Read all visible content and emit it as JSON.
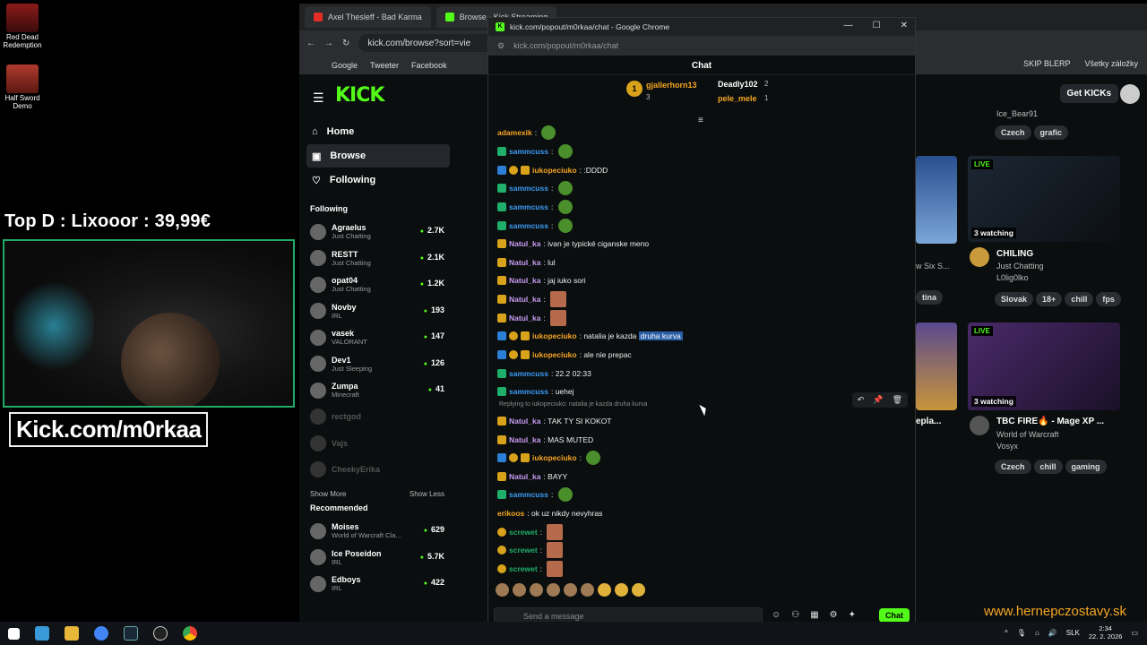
{
  "desktop": {
    "icons": [
      {
        "label": "Red Dead Redemption"
      },
      {
        "label": "Half Sword Demo"
      }
    ],
    "overlay_title": "Top D : Lixooor : 39,99€",
    "overlay_url": "Kick.com/m0rkaa",
    "watermark": "www.hernepczostavy.sk"
  },
  "back_browser": {
    "tabs": [
      {
        "label": "Axel Thesleff - Bad Karma"
      },
      {
        "label": "Browse - Kick Streaming"
      }
    ],
    "address": "kick.com/browse?sort=vie",
    "bookmarks": [
      "Google",
      "Tweeter",
      "Facebook"
    ],
    "bookmarks_right": [
      "SKIP BLERP",
      "Všetky záložky"
    ],
    "get_kicks": "Get KICKs",
    "logo": "KICK",
    "nav": [
      {
        "label": "Home",
        "icon": "home-icon"
      },
      {
        "label": "Browse",
        "icon": "browse-icon",
        "active": true
      },
      {
        "label": "Following",
        "icon": "heart-icon"
      }
    ],
    "following_title": "Following",
    "following": [
      {
        "name": "Agraelus",
        "sub": "Just Chatting",
        "viewers": "2.7K"
      },
      {
        "name": "RESTT",
        "sub": "Just Chatting",
        "viewers": "2.1K"
      },
      {
        "name": "opat04",
        "sub": "Just Chatting",
        "viewers": "1.2K"
      },
      {
        "name": "Novby",
        "sub": "IRL",
        "viewers": "193"
      },
      {
        "name": "vasek",
        "sub": "VALORANT",
        "viewers": "147"
      },
      {
        "name": "Dev1",
        "sub": "Just Sleeping",
        "viewers": "126"
      },
      {
        "name": "Zumpa",
        "sub": "Minecraft",
        "viewers": "41"
      }
    ],
    "offline": [
      "rectgod",
      "Vajs",
      "CheekyErika"
    ],
    "show_more": "Show More",
    "show_less": "Show Less",
    "recommended_title": "Recommended",
    "recommended": [
      {
        "name": "Moises",
        "sub": "World of Warcraft Cla...",
        "viewers": "629"
      },
      {
        "name": "Ice Poseidon",
        "sub": "IRL",
        "viewers": "5.7K"
      },
      {
        "name": "Edboys",
        "sub": "IRL",
        "viewers": "422"
      }
    ],
    "cards": [
      {
        "tags": [
          "Czech",
          "grafic"
        ],
        "top_text": "Ice_Bear91"
      },
      {
        "live": "LIVE",
        "watching": "3 watching",
        "title": "CHILING",
        "sub1": "Just Chatting",
        "sub2": "L0lig0lko",
        "tags": [
          "Slovak",
          "18+",
          "chill",
          "fps"
        ]
      },
      {
        "live": "LIVE",
        "watching": "3 watching",
        "title": "TBC FIRE🔥 - Mage XP ...",
        "sub1": "World of Warcraft",
        "sub2": "Vosyx",
        "tags": [
          "Czech",
          "chill",
          "gaming"
        ]
      }
    ],
    "partial_labels": [
      "w Six S...",
      "tina",
      "epla..."
    ]
  },
  "chat_window": {
    "title": "kick.com/popout/m0rkaa/chat - Google Chrome",
    "url": "kick.com/popout/m0rkaa/chat",
    "header": "Chat",
    "leaderboard": [
      {
        "rank": "1",
        "name": "gjallerhorn13",
        "count": "3"
      },
      {
        "name": "Deadly102",
        "count": "2"
      },
      {
        "name": "pele_mele",
        "count": "1"
      }
    ],
    "messages": [
      {
        "user": "adamexik",
        "color": "#f5a623",
        "text": "",
        "emote": "green"
      },
      {
        "user": "sammcuss",
        "color": "#3b9cf5",
        "text": "",
        "emote": "green",
        "badges": [
          "mod"
        ]
      },
      {
        "user": "iukopeciuko",
        "color": "#f5a623",
        "text": ":DDDD",
        "badges": [
          "sub",
          "gift",
          "crown"
        ]
      },
      {
        "user": "sammcuss",
        "color": "#3b9cf5",
        "text": "",
        "emote": "green",
        "badges": [
          "mod"
        ]
      },
      {
        "user": "sammcuss",
        "color": "#3b9cf5",
        "text": "",
        "emote": "green",
        "badges": [
          "mod"
        ]
      },
      {
        "user": "sammcuss",
        "color": "#3b9cf5",
        "text": "",
        "emote": "green",
        "badges": [
          "mod"
        ]
      },
      {
        "user": "Natul_ka",
        "color": "#c79bf2",
        "text": "ivan je typické ciganske meno",
        "badges": [
          "crown"
        ]
      },
      {
        "user": "Natul_ka",
        "color": "#c79bf2",
        "text": "lul",
        "badges": [
          "crown"
        ]
      },
      {
        "user": "Natul_ka",
        "color": "#c79bf2",
        "text": "jaj iuko sori",
        "badges": [
          "crown"
        ]
      },
      {
        "user": "Natul_ka",
        "color": "#c79bf2",
        "text": "",
        "emote": "img",
        "badges": [
          "crown"
        ]
      },
      {
        "user": "Natul_ka",
        "color": "#c79bf2",
        "text": "",
        "emote": "img",
        "badges": [
          "crown"
        ]
      },
      {
        "user": "iukopeciuko",
        "color": "#f5a623",
        "text": "natalia je kazda",
        "highlight": "druha kurva",
        "badges": [
          "sub",
          "gift",
          "crown"
        ]
      },
      {
        "user": "iukopeciuko",
        "color": "#f5a623",
        "text": "ale nie prepac",
        "badges": [
          "sub",
          "gift",
          "crown"
        ]
      },
      {
        "user": "sammcuss",
        "color": "#3b9cf5",
        "text": "22.2 02:33",
        "badges": [
          "mod"
        ]
      },
      {
        "user": "sammcuss",
        "color": "#3b9cf5",
        "text": "uehej",
        "badges": [
          "mod"
        ]
      },
      {
        "user": "Natul_ka",
        "color": "#c79bf2",
        "text": "TAK TY SI KOKOT",
        "badges": [
          "crown"
        ],
        "reply": "Replying to iukopeciuko: natalia je kazda druha kurva"
      },
      {
        "user": "Natul_ka",
        "color": "#c79bf2",
        "text": "MAS MUTED",
        "badges": [
          "crown"
        ]
      },
      {
        "user": "iukopeciuko",
        "color": "#f5a623",
        "text": "",
        "emote": "green",
        "badges": [
          "sub",
          "gift",
          "crown"
        ]
      },
      {
        "user": "Natul_ka",
        "color": "#c79bf2",
        "text": "BAYY",
        "badges": [
          "crown"
        ]
      },
      {
        "user": "sammcuss",
        "color": "#3b9cf5",
        "text": "",
        "emote": "green",
        "badges": [
          "mod"
        ]
      },
      {
        "user": "erikoos",
        "color": "#f5a623",
        "text": "ok uz nikdy nevyhras"
      },
      {
        "user": "screwet",
        "color": "#1eb06a",
        "text": "",
        "emote": "img",
        "badges": [
          "gift"
        ]
      },
      {
        "user": "screwet",
        "color": "#1eb06a",
        "text": "",
        "emote": "img",
        "badges": [
          "gift"
        ]
      },
      {
        "user": "screwet",
        "color": "#1eb06a",
        "text": "",
        "emote": "img",
        "badges": [
          "gift"
        ]
      }
    ],
    "input_placeholder": "Send a message",
    "chat_button": "Chat"
  },
  "taskbar": {
    "lang": "SLK",
    "time": "2:34",
    "date": "22. 2. 2026"
  }
}
